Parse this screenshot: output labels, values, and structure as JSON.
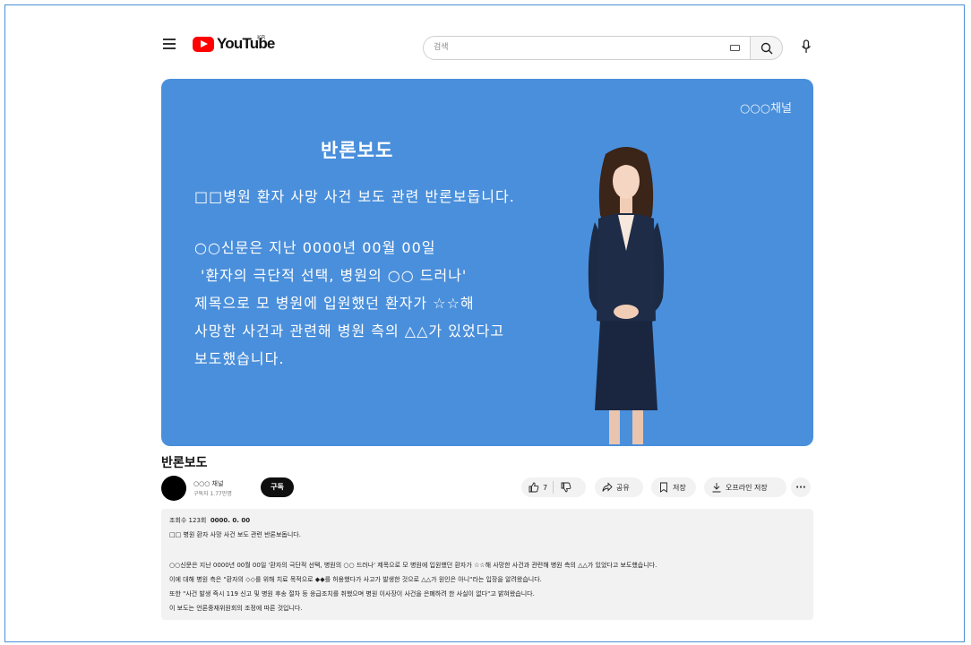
{
  "header": {
    "logo_text": "YouTube",
    "region": "KR",
    "search_placeholder": "검색"
  },
  "video": {
    "watermark": "○○○채널",
    "slide_title": "반론보도",
    "slide_lines": [
      "□□병원 환자 사망 사건 보도 관련 반론보돕니다.",
      "○○신문은 지난 0000년 00월 00일",
      "'환자의 극단적 선택, 병원의 ○○ 드러나'",
      "제목으로 모 병원에 입원했던 환자가 ☆☆해",
      "사망한 사건과 관련해 병원 측의 △△가 있었다고",
      "보도했습니다."
    ]
  },
  "title": "반론보도",
  "channel": {
    "name": "○○○ 채널",
    "subscribers": "구독자 1.77만명",
    "subscribe_label": "구독"
  },
  "actions": {
    "likes": "7",
    "share": "공유",
    "save": "저장",
    "offline": "오프라인 저장",
    "more": "···"
  },
  "description": {
    "views": "조회수 123회",
    "date": "0000. 0. 00",
    "lines": [
      "□□ 병원 환자 사망 사건 보도 관련 반론보돕니다.",
      "○○신문은 지난 0000년 00월 00일 '환자의 극단적 선택, 병원의 ○○ 드러나' 제목으로 모 병원에 입원했던 환자가 ☆☆해 사망한 사건과 관련해 병원 측의 △△가 있었다고 보도했습니다.",
      "이에 대해 병원 측은 \"환자의 ◇◇를 위해 치료 목적으로 ◆◆를 허용했다가 사고가 발생한 것으로 △△가 원인은 아니\"라는 입장을 알려왔습니다.",
      "또한 \"사건 발생 즉시 119 신고 및 병원 후송 절차 등 응급조치를 취했으며 병원 이사장이 사건을 은폐하려 한 사실이 없다\"고 밝혀왔습니다.",
      "이 보도는 언론중재위원회의 조정에 따른 것입니다."
    ]
  },
  "colors": {
    "video_bg": "#4a8fdb",
    "brand_red": "#ff0000"
  }
}
